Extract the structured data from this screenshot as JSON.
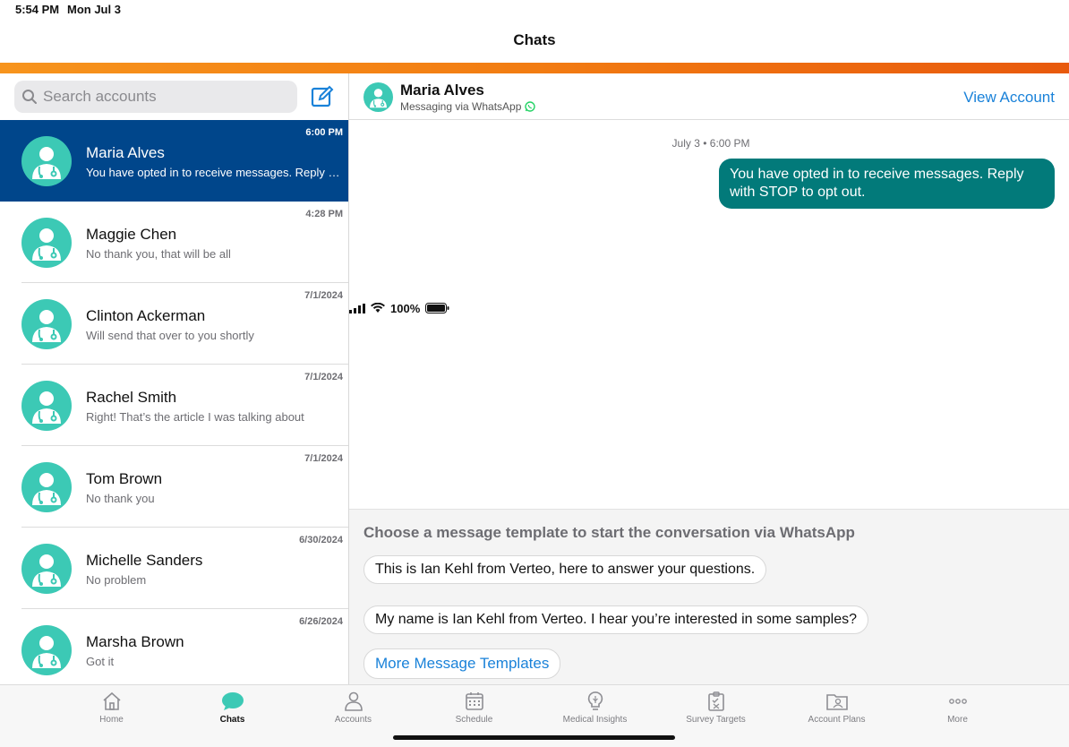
{
  "status": {
    "time": "5:54 PM",
    "date": "Mon Jul 3",
    "battery": "100%"
  },
  "nav": {
    "title": "Chats"
  },
  "search": {
    "placeholder": "Search accounts"
  },
  "chats": [
    {
      "name": "Maria Alves",
      "preview": "You have opted in to receive messages. Reply with STOP to opt out.",
      "time": "6:00 PM",
      "active": true
    },
    {
      "name": "Maggie Chen",
      "preview": "No thank you, that will be all",
      "time": "4:28 PM"
    },
    {
      "name": "Clinton Ackerman",
      "preview": "Will send that over to you shortly",
      "time": "7/1/2024"
    },
    {
      "name": "Rachel Smith",
      "preview": "Right! That’s the article I was talking about",
      "time": "7/1/2024"
    },
    {
      "name": "Tom Brown",
      "preview": "No thank you",
      "time": "7/1/2024"
    },
    {
      "name": "Michelle Sanders",
      "preview": "No problem",
      "time": "6/30/2024"
    },
    {
      "name": "Marsha Brown",
      "preview": "Got it",
      "time": "6/26/2024"
    }
  ],
  "conversation": {
    "name": "Maria Alves",
    "via": "Messaging via WhatsApp",
    "view_account": "View Account",
    "date": "July 3",
    "time": "6:00 PM",
    "message": "You have opted in to receive messages. Reply with STOP to opt out."
  },
  "templates": {
    "title": "Choose a message template to start the conversation via WhatsApp",
    "items": [
      "This is Ian Kehl from Verteo, here to answer your questions.",
      "My name is Ian Kehl from Verteo. I hear you’re interested in some samples?"
    ],
    "more": "More Message Templates"
  },
  "tabs": [
    "Home",
    "Chats",
    "Accounts",
    "Schedule",
    "Medical Insights",
    "Survey Targets",
    "Account Plans",
    "More"
  ],
  "colors": {
    "accent_orange": "#f27c12",
    "selected_row": "#00468b",
    "bubble": "#027a7a",
    "link": "#1a82d9",
    "avatar": "#3cc9b5"
  }
}
